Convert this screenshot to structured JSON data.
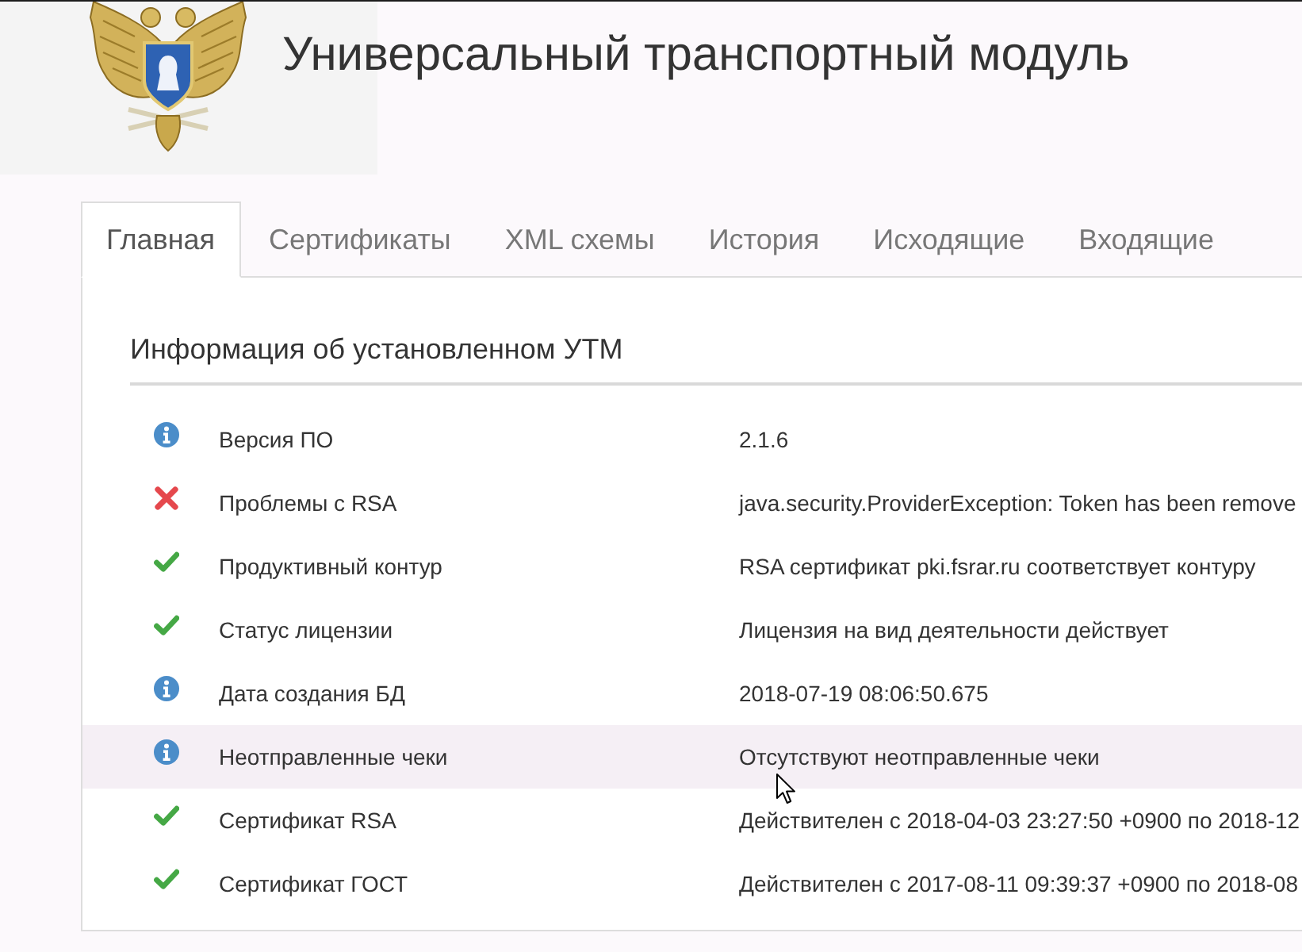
{
  "header": {
    "title": "Универсальный транспортный модуль"
  },
  "tabs": [
    {
      "label": "Главная",
      "selected": true
    },
    {
      "label": "Сертификаты",
      "selected": false
    },
    {
      "label": "XML схемы",
      "selected": false
    },
    {
      "label": "История",
      "selected": false
    },
    {
      "label": "Исходящие",
      "selected": false
    },
    {
      "label": "Входящие",
      "selected": false
    }
  ],
  "section": {
    "title": "Информация об установленном УТМ",
    "rows": [
      {
        "kind": "info",
        "label": "Версия ПО",
        "value": "2.1.6",
        "highlighted": false
      },
      {
        "kind": "error",
        "label": "Проблемы с RSA",
        "value": "java.security.ProviderException: Token has been remove",
        "highlighted": false
      },
      {
        "kind": "ok",
        "label": "Продуктивный контур",
        "value": "RSA сертификат pki.fsrar.ru соответствует контуру",
        "highlighted": false
      },
      {
        "kind": "ok",
        "label": "Статус лицензии",
        "value": "Лицензия на вид деятельности действует",
        "highlighted": false
      },
      {
        "kind": "info",
        "label": "Дата создания БД",
        "value": "2018-07-19 08:06:50.675",
        "highlighted": false
      },
      {
        "kind": "info",
        "label": "Неотправленные чеки",
        "value": "Отсутствуют неотправленные чеки",
        "highlighted": true
      },
      {
        "kind": "ok",
        "label": "Сертификат RSA",
        "value": "Действителен с 2018-04-03 23:27:50 +0900 по 2018-12",
        "highlighted": false
      },
      {
        "kind": "ok",
        "label": "Сертификат ГОСТ",
        "value": "Действителен с 2017-08-11 09:39:37 +0900 по 2018-08",
        "highlighted": false
      }
    ]
  }
}
